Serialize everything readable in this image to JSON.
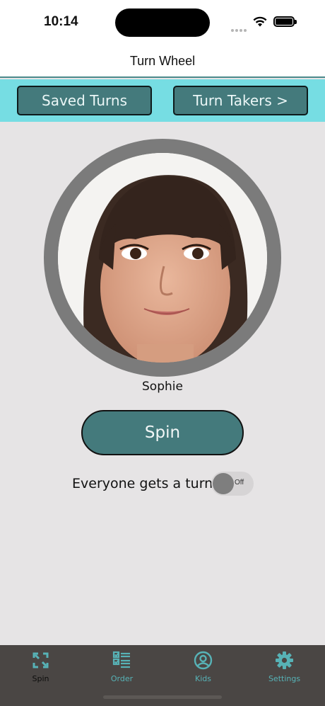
{
  "status_bar": {
    "time": "10:14"
  },
  "nav": {
    "title": "Turn Wheel"
  },
  "top_buttons": {
    "saved_turns": "Saved Turns",
    "turn_takers": "Turn Takers >"
  },
  "current_taker": {
    "name": "Sophie"
  },
  "spin_button": "Spin",
  "everyone_toggle": {
    "label": "Everyone gets a turn",
    "state": "Off"
  },
  "tabs": [
    {
      "label": "Spin",
      "icon": "spin-arrows-icon",
      "active": true
    },
    {
      "label": "Order",
      "icon": "checklist-icon",
      "active": false
    },
    {
      "label": "Kids",
      "icon": "person-circle-icon",
      "active": false
    },
    {
      "label": "Settings",
      "icon": "gear-icon",
      "active": false
    }
  ],
  "colors": {
    "accent": "#447a7c",
    "topbar": "#76dde3",
    "tabbar": "#4a4644",
    "tab_inactive": "#57b2b6"
  }
}
